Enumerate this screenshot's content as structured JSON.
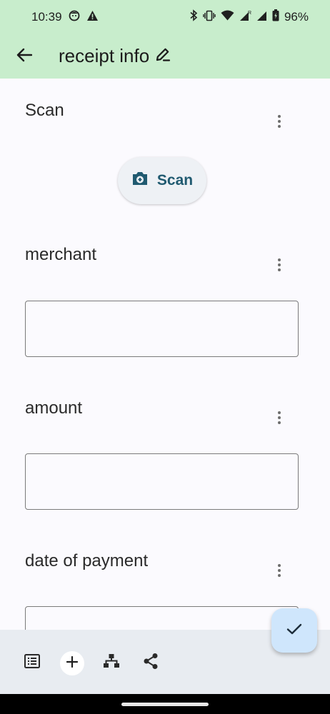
{
  "status_bar": {
    "time": "10:39",
    "battery_percent": "96%",
    "icons": [
      "face-icon",
      "warning-icon",
      "bluetooth-icon",
      "vibrate-icon",
      "wifi-icon",
      "signal-r-icon",
      "signal-icon",
      "battery-icon"
    ]
  },
  "app_bar": {
    "title": "receipt info",
    "back_icon": "back-arrow-icon",
    "edit_icon": "edit-pencil-icon"
  },
  "fields": {
    "scan": {
      "label": "Scan",
      "button_label": "Scan",
      "button_icon": "camera-add-icon"
    },
    "merchant": {
      "label": "merchant",
      "value": ""
    },
    "amount": {
      "label": "amount",
      "value": ""
    },
    "date_of_payment": {
      "label": "date of payment",
      "value": ""
    }
  },
  "bottom_bar": {
    "icons": [
      "list-icon",
      "add-icon",
      "hierarchy-icon",
      "share-icon"
    ]
  },
  "fab": {
    "icon": "check-icon"
  },
  "colors": {
    "app_bar_bg": "#C8EDCC",
    "page_bg": "#FBFAFE",
    "scan_text": "#205A70",
    "fab_bg": "#CFE6FC",
    "bottom_bar_bg": "#E8ECF1"
  }
}
